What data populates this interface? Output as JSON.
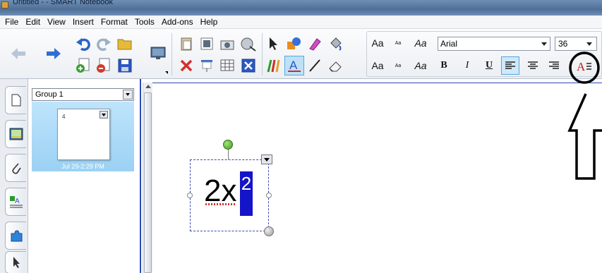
{
  "window": {
    "title": "Untitled - - SMART Notebook"
  },
  "menubar": {
    "items": [
      "File",
      "Edit",
      "View",
      "Insert",
      "Format",
      "Tools",
      "Add-ons",
      "Help"
    ]
  },
  "toolbar": {
    "font_name": "Arial",
    "font_size": "36",
    "aa_large": "Aa",
    "aa_small": "Aa",
    "aa_script": "Aa",
    "bold": "B",
    "italic": "I",
    "underline": "U"
  },
  "sorter": {
    "group_label": "Group 1",
    "page_date": "Jul 29-2:29 PM",
    "thumb_mark": "4"
  },
  "canvas": {
    "expression_base": "2x",
    "expression_superscript": "2"
  },
  "colors": {
    "accent": "#2c4ab8",
    "selection": "#1414c8",
    "annotation": "#000000"
  }
}
